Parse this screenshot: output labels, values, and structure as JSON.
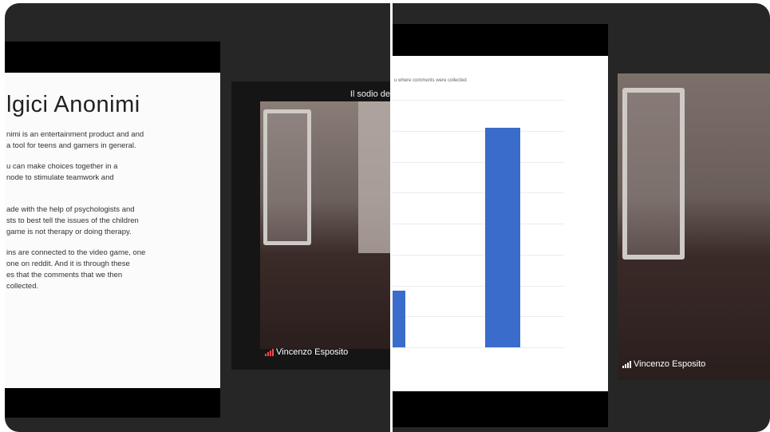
{
  "left_panel": {
    "slide": {
      "title": "lgici Anonimi",
      "bullets": [
        "nimi is an entertainment product and and\na tool for teens and gamers in general.",
        "u can make choices together in a\nnode to stimulate teamwork and",
        "ade with the help of psychologists and\nsts to best tell the issues of the children\ngame is not therapy or doing therapy.",
        "ins are connected to the video game, one\none on reddit. And it is through these\nes that the comments that we then\ncollected."
      ]
    },
    "video": {
      "caption": "Il sodio de",
      "participant_name": "Vincenzo Esposito"
    }
  },
  "right_panel": {
    "slide": {
      "chart_title": "u where comments were collected"
    },
    "video": {
      "participant_name": "Vincenzo Esposito"
    }
  },
  "chart_data": {
    "type": "bar",
    "title": "u where comments were collected",
    "categories": [
      "",
      ""
    ],
    "values": [
      40,
      155
    ],
    "ylim": [
      0,
      175
    ],
    "grid": true,
    "colors": [
      "#3a6ccb"
    ]
  }
}
